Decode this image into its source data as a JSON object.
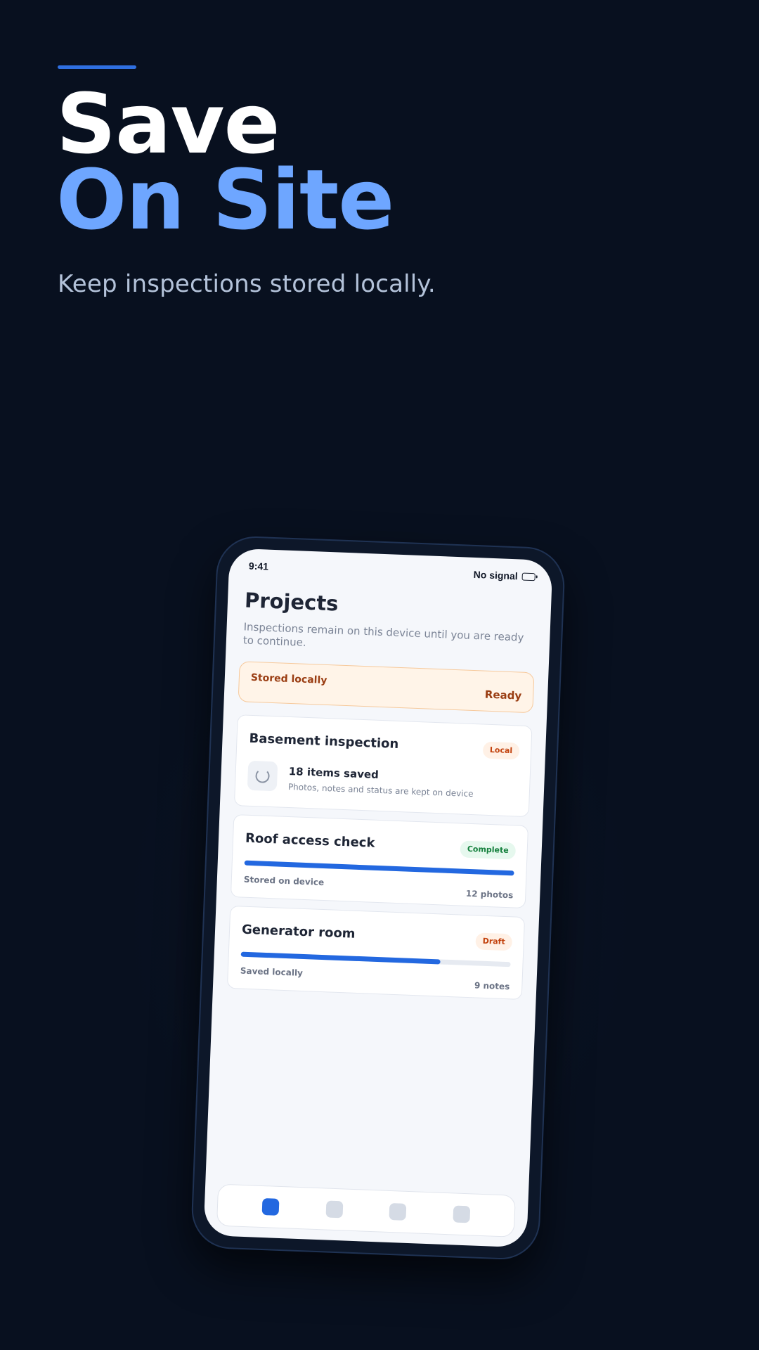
{
  "hero": {
    "title_line1": "Save",
    "title_line2": "On Site",
    "subtitle": "Keep inspections stored locally.",
    "accent_color": "#2f6fe0",
    "highlight_color": "#6ea6ff"
  },
  "status_bar": {
    "time": "9:41",
    "signal": "No signal",
    "battery_icon": "battery-icon"
  },
  "screen": {
    "title": "Projects",
    "description": "Inspections remain on this device until you are ready to continue."
  },
  "banner": {
    "left": "Stored locally",
    "right": "Ready"
  },
  "cards": [
    {
      "title": "Basement inspection",
      "badge": "Local",
      "count": "18 items saved",
      "detail": "Photos, notes and status are kept on device",
      "icon": "loading-spinner-icon"
    },
    {
      "title": "Roof access check",
      "badge": "Complete",
      "progress": 1.0,
      "meta_left": "Stored on device",
      "meta_right": "12 photos"
    },
    {
      "title": "Generator room",
      "badge": "Draft",
      "progress": 0.74,
      "meta_left": "Saved locally",
      "meta_right": "9 notes"
    }
  ],
  "tabs": [
    {
      "icon": "tab-1-icon",
      "active": true
    },
    {
      "icon": "tab-2-icon",
      "active": false
    },
    {
      "icon": "tab-3-icon",
      "active": false
    },
    {
      "icon": "tab-4-icon",
      "active": false
    }
  ]
}
